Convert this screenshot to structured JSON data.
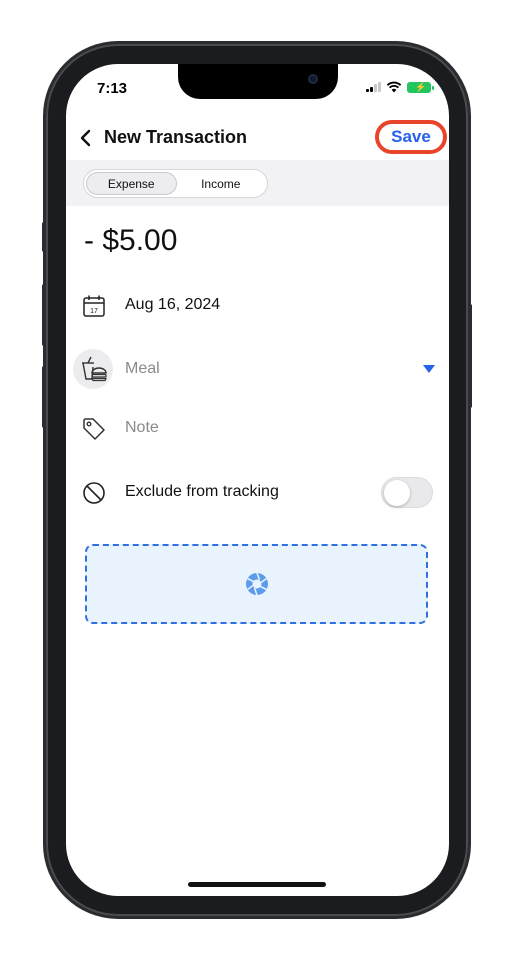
{
  "status_bar": {
    "time": "7:13"
  },
  "header": {
    "title": "New Transaction",
    "save_label": "Save"
  },
  "segmented": {
    "options": [
      "Expense",
      "Income"
    ],
    "selected": "Expense"
  },
  "amount": "- $5.00",
  "fields": {
    "date": "Aug 16, 2024",
    "category": "Meal",
    "note_placeholder": "Note",
    "exclude_label": "Exclude from tracking",
    "exclude_enabled": false
  },
  "icons": {
    "back": "chevron-left-icon",
    "calendar": "calendar-icon",
    "meal": "meal-icon",
    "note": "tag-icon",
    "exclude": "prohibit-icon",
    "attachment": "camera-aperture-icon"
  },
  "colors": {
    "accent": "#2563eb",
    "highlight": "#e8442a",
    "attachment_bg": "#e8f3fd"
  }
}
